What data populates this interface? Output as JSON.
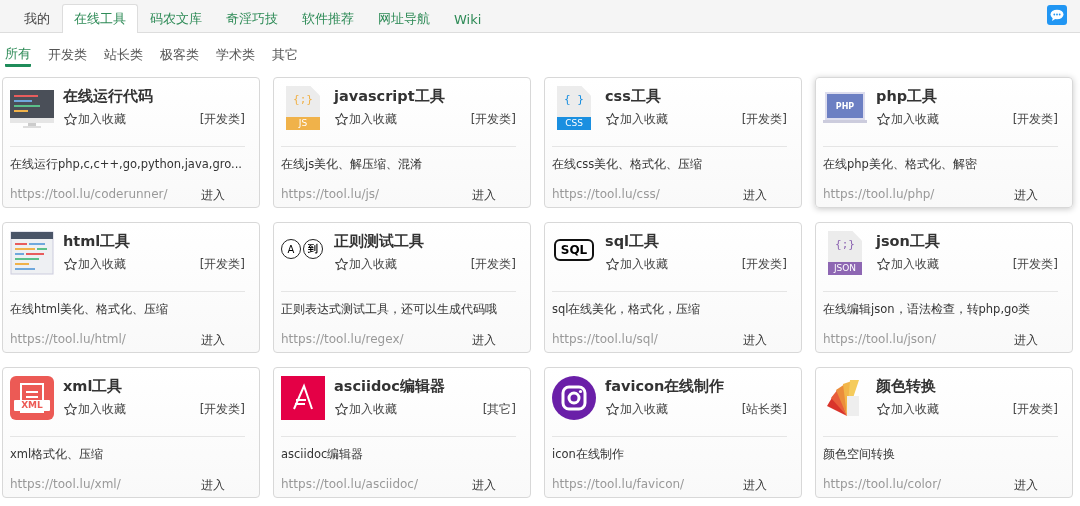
{
  "tabs": [
    {
      "label": "我的",
      "selected": false
    },
    {
      "label": "在线工具",
      "selected": true
    },
    {
      "label": "码农文库",
      "selected": false
    },
    {
      "label": "奇淫巧技",
      "selected": false
    },
    {
      "label": "软件推荐",
      "selected": false
    },
    {
      "label": "网址导航",
      "selected": false
    },
    {
      "label": "Wiki",
      "selected": false
    }
  ],
  "subtabs": [
    {
      "label": "所有",
      "selected": true
    },
    {
      "label": "开发类",
      "selected": false
    },
    {
      "label": "站长类",
      "selected": false
    },
    {
      "label": "极客类",
      "selected": false
    },
    {
      "label": "学术类",
      "selected": false
    },
    {
      "label": "其它",
      "selected": false
    }
  ],
  "cards": [
    {
      "kind": "monitor",
      "title": "在线运行代码",
      "favorite": "加入收藏",
      "category": "[开发类]",
      "description": "在线运行php,c,c++,go,python,java,gro...",
      "url": "https://tool.lu/coderunner/",
      "enter": "进入",
      "hovered": false
    },
    {
      "kind": "js-file",
      "icon_labels": [
        "{;}",
        "JS"
      ],
      "title": "javascript工具",
      "favorite": "加入收藏",
      "category": "[开发类]",
      "description": "在线js美化、解压缩、混淆",
      "url": "https://tool.lu/js/",
      "enter": "进入",
      "hovered": false
    },
    {
      "kind": "css-file",
      "icon_labels": [
        "{ }",
        "CSS"
      ],
      "title": "css工具",
      "favorite": "加入收藏",
      "category": "[开发类]",
      "description": "在线css美化、格式化、压缩",
      "url": "https://tool.lu/css/",
      "enter": "进入",
      "hovered": false
    },
    {
      "kind": "laptop",
      "icon_labels": [
        "PHP"
      ],
      "title": "php工具",
      "favorite": "加入收藏",
      "category": "[开发类]",
      "description": "在线php美化、格式化、解密",
      "url": "https://tool.lu/php/",
      "enter": "进入",
      "hovered": true
    },
    {
      "kind": "code-page",
      "title": "html工具",
      "favorite": "加入收藏",
      "category": "[开发类]",
      "description": "在线html美化、格式化、压缩",
      "url": "https://tool.lu/html/",
      "enter": "进入",
      "hovered": false
    },
    {
      "kind": "bubbles",
      "icon_labels": [
        "A",
        "到"
      ],
      "title": "正则测试工具",
      "favorite": "加入收藏",
      "category": "[开发类]",
      "description": "正则表达式测试工具，还可以生成代码哦",
      "url": "https://tool.lu/regex/",
      "enter": "进入",
      "hovered": false
    },
    {
      "kind": "outlined",
      "icon_labels": [
        "SQL"
      ],
      "title": "sql工具",
      "favorite": "加入收藏",
      "category": "[开发类]",
      "description": "sql在线美化，格式化，压缩",
      "url": "https://tool.lu/sql/",
      "enter": "进入",
      "hovered": false
    },
    {
      "kind": "json-file",
      "icon_labels": [
        "{;}",
        "JSON"
      ],
      "title": "json工具",
      "favorite": "加入收藏",
      "category": "[开发类]",
      "description": "在线编辑json，语法检查，转php,go类",
      "url": "https://tool.lu/json/",
      "enter": "进入",
      "hovered": false
    },
    {
      "kind": "xml-doc",
      "icon_labels": [
        "XML"
      ],
      "title": "xml工具",
      "favorite": "加入收藏",
      "category": "[开发类]",
      "description": "xml格式化、压缩",
      "url": "https://tool.lu/xml/",
      "enter": "进入",
      "hovered": false
    },
    {
      "kind": "asciidoc",
      "title": "asciidoc编辑器",
      "favorite": "加入收藏",
      "category": "[其它]",
      "description": "asciidoc编辑器",
      "url": "https://tool.lu/asciidoc/",
      "enter": "进入",
      "hovered": false
    },
    {
      "kind": "camera",
      "title": "favicon在线制作",
      "favorite": "加入收藏",
      "category": "[站长类]",
      "description": "icon在线制作",
      "url": "https://tool.lu/favicon/",
      "enter": "进入",
      "hovered": false
    },
    {
      "kind": "swatches",
      "title": "颜色转换",
      "favorite": "加入收藏",
      "category": "[开发类]",
      "description": "颜色空间转换",
      "url": "https://tool.lu/color/",
      "enter": "进入",
      "hovered": false
    }
  ]
}
